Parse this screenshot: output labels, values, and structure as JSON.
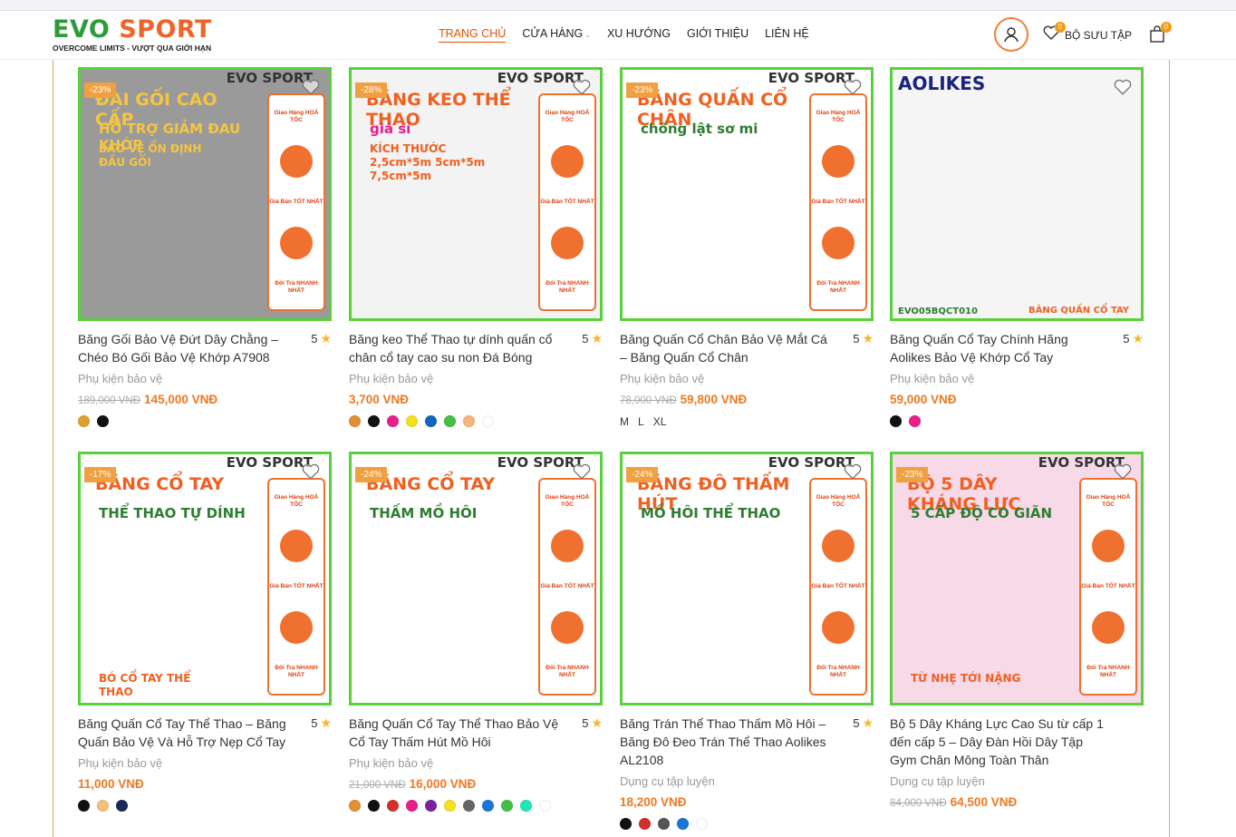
{
  "header": {
    "logo_main_evo": "EVO",
    "logo_main_sport": " SPORT",
    "logo_tagline": "OVERCOME LIMITS - VƯỢT QUA GIỚI HẠN",
    "nav": [
      {
        "label": "TRANG CHỦ",
        "active": true
      },
      {
        "label": "CỬA HÀNG",
        "caret": "⌄"
      },
      {
        "label": "XU HƯỚNG"
      },
      {
        "label": "GIỚI THIỆU"
      },
      {
        "label": "LIÊN HỆ"
      }
    ],
    "wishlist_label": "BỘ SƯU TẬP",
    "wishlist_count": "0",
    "cart_count": "0"
  },
  "products": [
    {
      "sale": "-23%",
      "title": "Băng Gối Bảo Vệ Đứt Dây Chằng – Chéo Bó Gối Bảo Vệ Khớp A7908",
      "rating": "5",
      "category": "Phụ kiện bảo vệ",
      "old_price": "189,000 VNĐ",
      "price": "145,000 VNĐ",
      "swatches": [
        "#e0a030",
        "#111111"
      ],
      "img_heading": "ĐAI GỐI CAO CẤP",
      "img_sub": "HỖ TRỢ GIẢM ĐAU KHỚP",
      "img_sub2": "BẢO VỆ ỔN ĐỊNH ĐẦU GỐI"
    },
    {
      "sale": "-28%",
      "title": "Băng keo Thể Thao tự dính quấn cổ chân cổ tay cao su non Đá Bóng",
      "rating": "5",
      "category": "Phụ kiện bảo vệ",
      "old_price": "",
      "price": "3,700 VNĐ",
      "swatches": [
        "#e09030",
        "#111111",
        "#e91e8c",
        "#f5e020",
        "#1565c0",
        "#43c043",
        "#f4b67a",
        "#ffffff"
      ],
      "img_heading": "BĂNG KEO THỂ THAO",
      "img_sub": "giá sỉ",
      "img_sub2": "KÍCH THƯỚC 2,5cm*5m 5cm*5m 7,5cm*5m"
    },
    {
      "sale": "-23%",
      "title": "Băng Quấn Cổ Chân Bảo Vệ Mắt Cá – Băng Quấn Cổ Chân",
      "rating": "5",
      "category": "Phụ kiện bảo vệ",
      "old_price": "78,000 VNĐ",
      "price": "59,800 VNĐ",
      "sizes": [
        "M",
        "L",
        "XL"
      ],
      "img_heading": "BĂNG QUẤN CỔ CHÂN",
      "img_sub": "chống lật sơ mi",
      "img_sub2": ""
    },
    {
      "sale": "",
      "title": "Băng Quấn Cổ Tay Chính Hãng Aolikes Bảo Vệ Khớp Cổ Tay",
      "rating": "5",
      "category": "Phụ kiện bảo vệ",
      "old_price": "",
      "price": "59,000 VNĐ",
      "swatches": [
        "#111111",
        "#e91e8c"
      ],
      "img_heading": "AOLIKES",
      "img_sub": "EVO05BQCT010",
      "img_sub2": "BĂNG QUẤN CỔ TAY"
    },
    {
      "sale": "-17%",
      "title": "Băng Quấn Cổ Tay Thể Thao – Băng Quấn Bảo Vệ Và Hỗ Trợ Nẹp Cổ Tay",
      "rating": "5",
      "category": "Phụ kiện bảo vệ",
      "old_price": "",
      "price": "11,000 VNĐ",
      "swatches": [
        "#111111",
        "#f4c07a",
        "#1a2a5a"
      ],
      "img_heading": "BĂNG CỔ TAY",
      "img_sub": "THỂ THAO TỰ DÍNH",
      "img_sub2": "BÓ CỔ TAY THỂ THAO"
    },
    {
      "sale": "-24%",
      "title": "Băng Quấn Cổ Tay Thể Thao Bảo Vệ Cổ Tay Thấm Hút Mồ Hôi",
      "rating": "5",
      "category": "Phụ kiện bảo vệ",
      "old_price": "21,000 VNĐ",
      "price": "16,000 VNĐ",
      "swatches": [
        "#e09030",
        "#111111",
        "#d32f2f",
        "#e91e8c",
        "#7b1fa2",
        "#f5e020",
        "#666666",
        "#1976d2",
        "#43c043",
        "#1de9b6",
        "#ffffff"
      ],
      "img_heading": "BĂNG CỔ TAY",
      "img_sub": "THẤM MỒ HÔI",
      "img_sub2": ""
    },
    {
      "sale": "-24%",
      "title": "Băng Trán Thể Thao Thấm Mồ Hôi – Băng Đô Đeo Trán Thể Thao Aolikes AL2108",
      "rating": "5",
      "category": "Dụng cụ tập luyện",
      "old_price": "",
      "price": "18,200 VNĐ",
      "swatches": [
        "#111111",
        "#d32f2f",
        "#555555",
        "#1976d2",
        "#ffffff"
      ],
      "img_heading": "BĂNG ĐÔ THẤM HÚT",
      "img_sub": "MỒ HÔI THỂ THAO",
      "img_sub2": ""
    },
    {
      "sale": "-23%",
      "title": "Bộ 5 Dây Kháng Lực Cao Su từ cấp 1 đến cấp 5 – Dây Đàn Hồi Dây Tập Gym Chân Mông Toàn Thân",
      "rating": "",
      "category": "Dụng cụ tập luyện",
      "old_price": "84,000 VNĐ",
      "price": "64,500 VNĐ",
      "swatches": [],
      "img_heading": "BỘ 5 DÂY KHÁNG LỰC",
      "img_sub": "5 CẤP ĐỘ CO GIÃN",
      "img_sub2": "TỪ NHẸ TỚI NẶNG"
    }
  ],
  "panel": {
    "ship": "Giao Hàng HOẢ TỐC",
    "price": "Giá Bán TỐT NHẤT",
    "return": "Đổi Trả NHANH NHẤT"
  },
  "img_brand": "EVO SPORT",
  "colors": {
    "accent": "#f07820",
    "frame": "#56d33b",
    "badge": "#f0a040"
  }
}
